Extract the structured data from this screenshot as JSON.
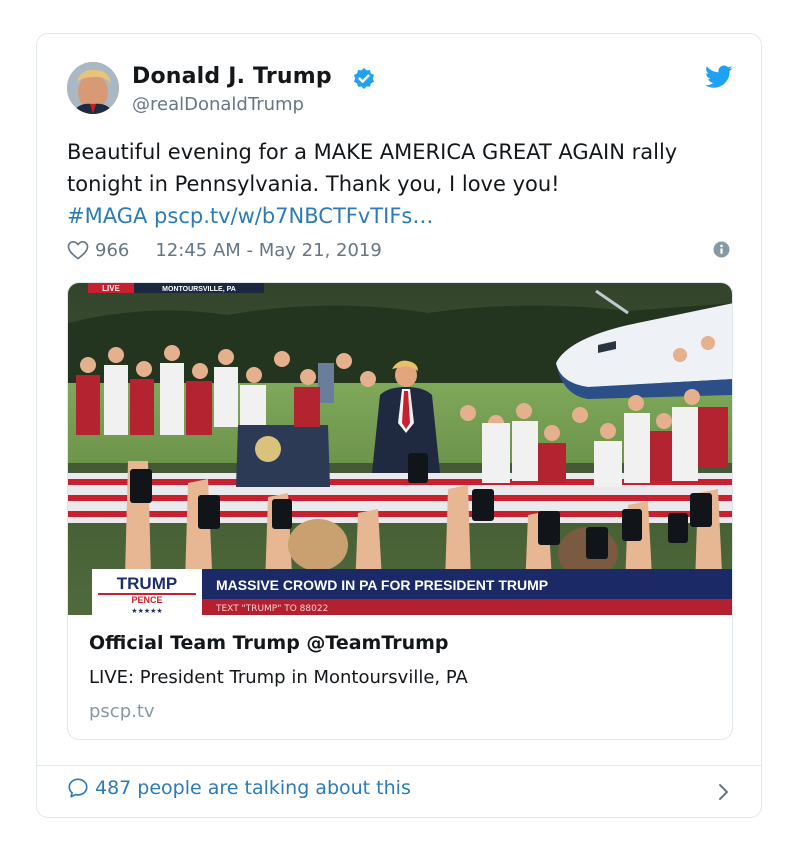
{
  "author": {
    "name": "Donald J. Trump",
    "handle": "@realDonaldTrump"
  },
  "tweet": {
    "text_plain": "Beautiful evening for a MAKE AMERICA GREAT AGAIN rally tonight in Pennsylvania. Thank you, I love you!",
    "hashtag": "#MAGA",
    "link": "pscp.tv/w/b7NBCTFvTIFs…",
    "likes": "966",
    "timestamp": "12:45 AM - May 21, 2019"
  },
  "media": {
    "live_badge": "LIVE",
    "location_badge": "MONTOURSVILLE, PA",
    "banner_logo_top": "TRUMP",
    "banner_logo_bottom": "PENCE",
    "banner_stars": "★★★★★",
    "banner_headline": "MASSIVE CROWD IN PA FOR PRESIDENT TRUMP",
    "banner_subtext": "TEXT \"TRUMP\" TO 88022"
  },
  "card": {
    "title": "Official Team Trump @TeamTrump",
    "description": "LIVE: President Trump in Montoursville, PA",
    "domain": "pscp.tv"
  },
  "footer": {
    "talking": "487 people are talking about this"
  },
  "colors": {
    "link": "#2b7bb9",
    "verified": "#1da1f2",
    "muted": "#657786",
    "border": "#e1e8ed"
  }
}
